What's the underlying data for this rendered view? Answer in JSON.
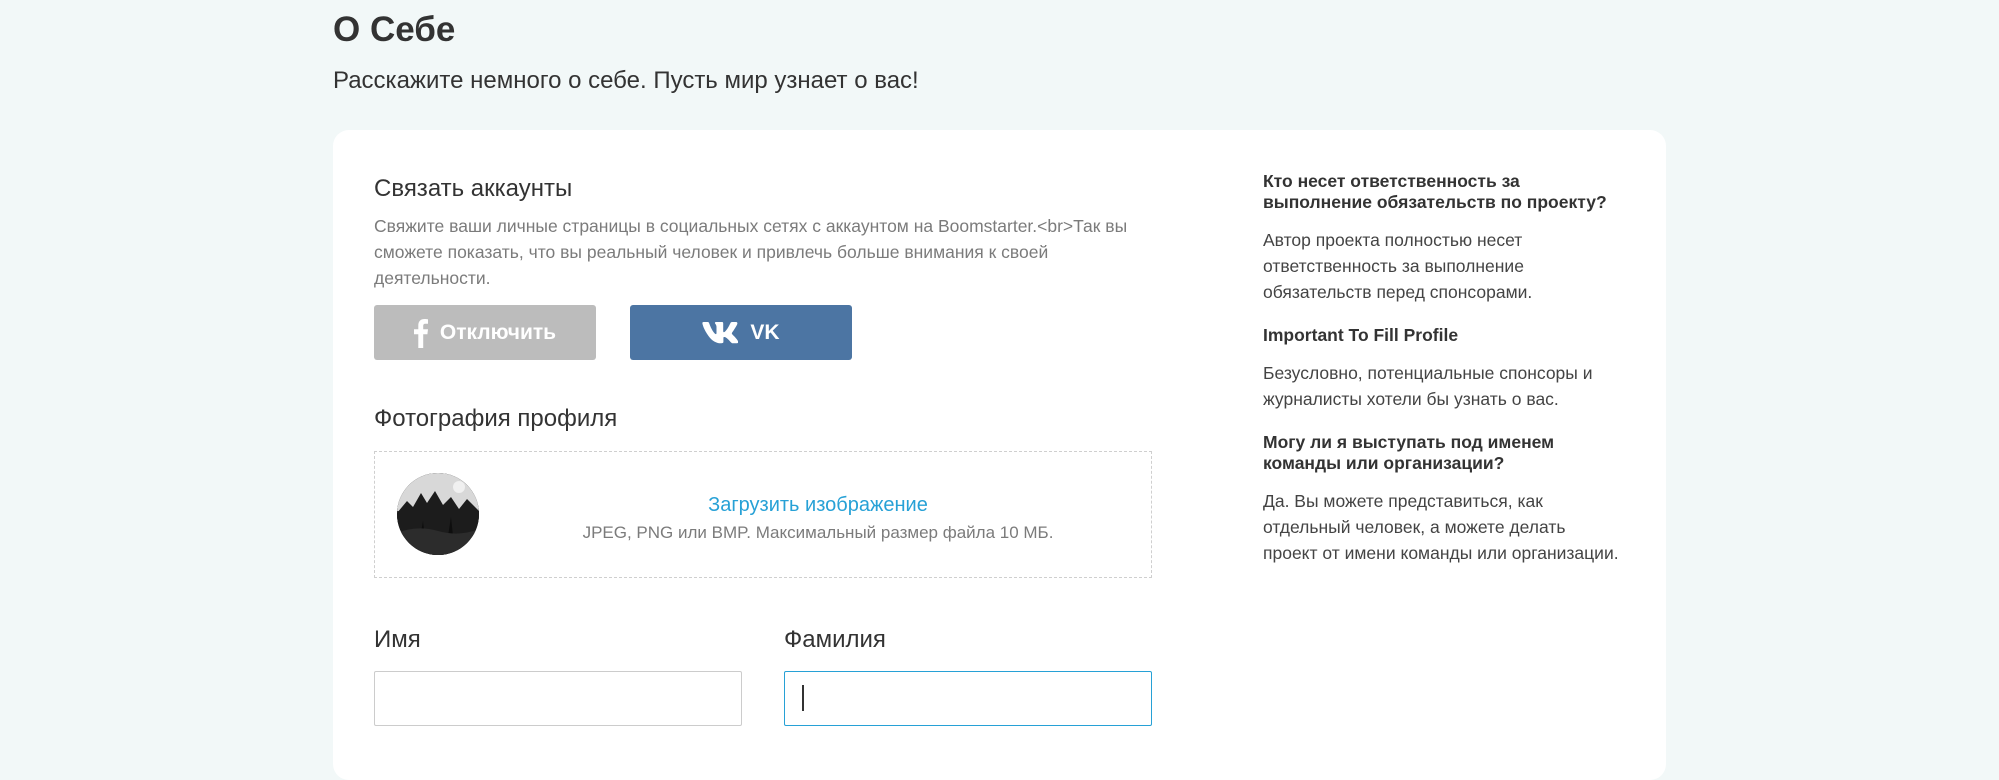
{
  "header": {
    "title": "О Себе",
    "subtitle": "Расскажите немного о себе. Пусть мир узнает о вас!"
  },
  "accounts": {
    "title": "Связать аккаунты",
    "description": "Свяжите ваши личные страницы в социальных сетях с аккаунтом на Boomstarter.<br>Так вы сможете показать, что вы реальный человек и привлечь больше внимания к своей деятельности.",
    "facebook_button": "Отключить",
    "vk_button": "VK",
    "facebook_color": "#bcbcbc",
    "vk_color": "#4c75a3"
  },
  "photo": {
    "title": "Фотография профиля",
    "upload_link": "Загрузить изображение",
    "upload_hint": "JPEG, PNG или BMP. Максимальный размер файла 10 МБ."
  },
  "fields": {
    "first_name_label": "Имя",
    "first_name_value": "",
    "last_name_label": "Фамилия",
    "last_name_value": ""
  },
  "faq": [
    {
      "question": "Кто несет ответственность за выполнение обязательств по проекту?",
      "answer": "Автор проекта полностью несет ответственность за выполнение обязательств перед спонсорами."
    },
    {
      "question": "Important To Fill Profile",
      "answer": "Безусловно, потенциальные спонсоры и журналисты хотели бы узнать о вас."
    },
    {
      "question": "Могу ли я выступать под именем команды или организации?",
      "answer": "Да. Вы можете представиться, как отдельный человек, а можете делать проект от имени команды или организации."
    }
  ],
  "colors": {
    "link": "#27a1d6",
    "focus_border": "#27a1d6",
    "background": "#f2f8f8"
  }
}
